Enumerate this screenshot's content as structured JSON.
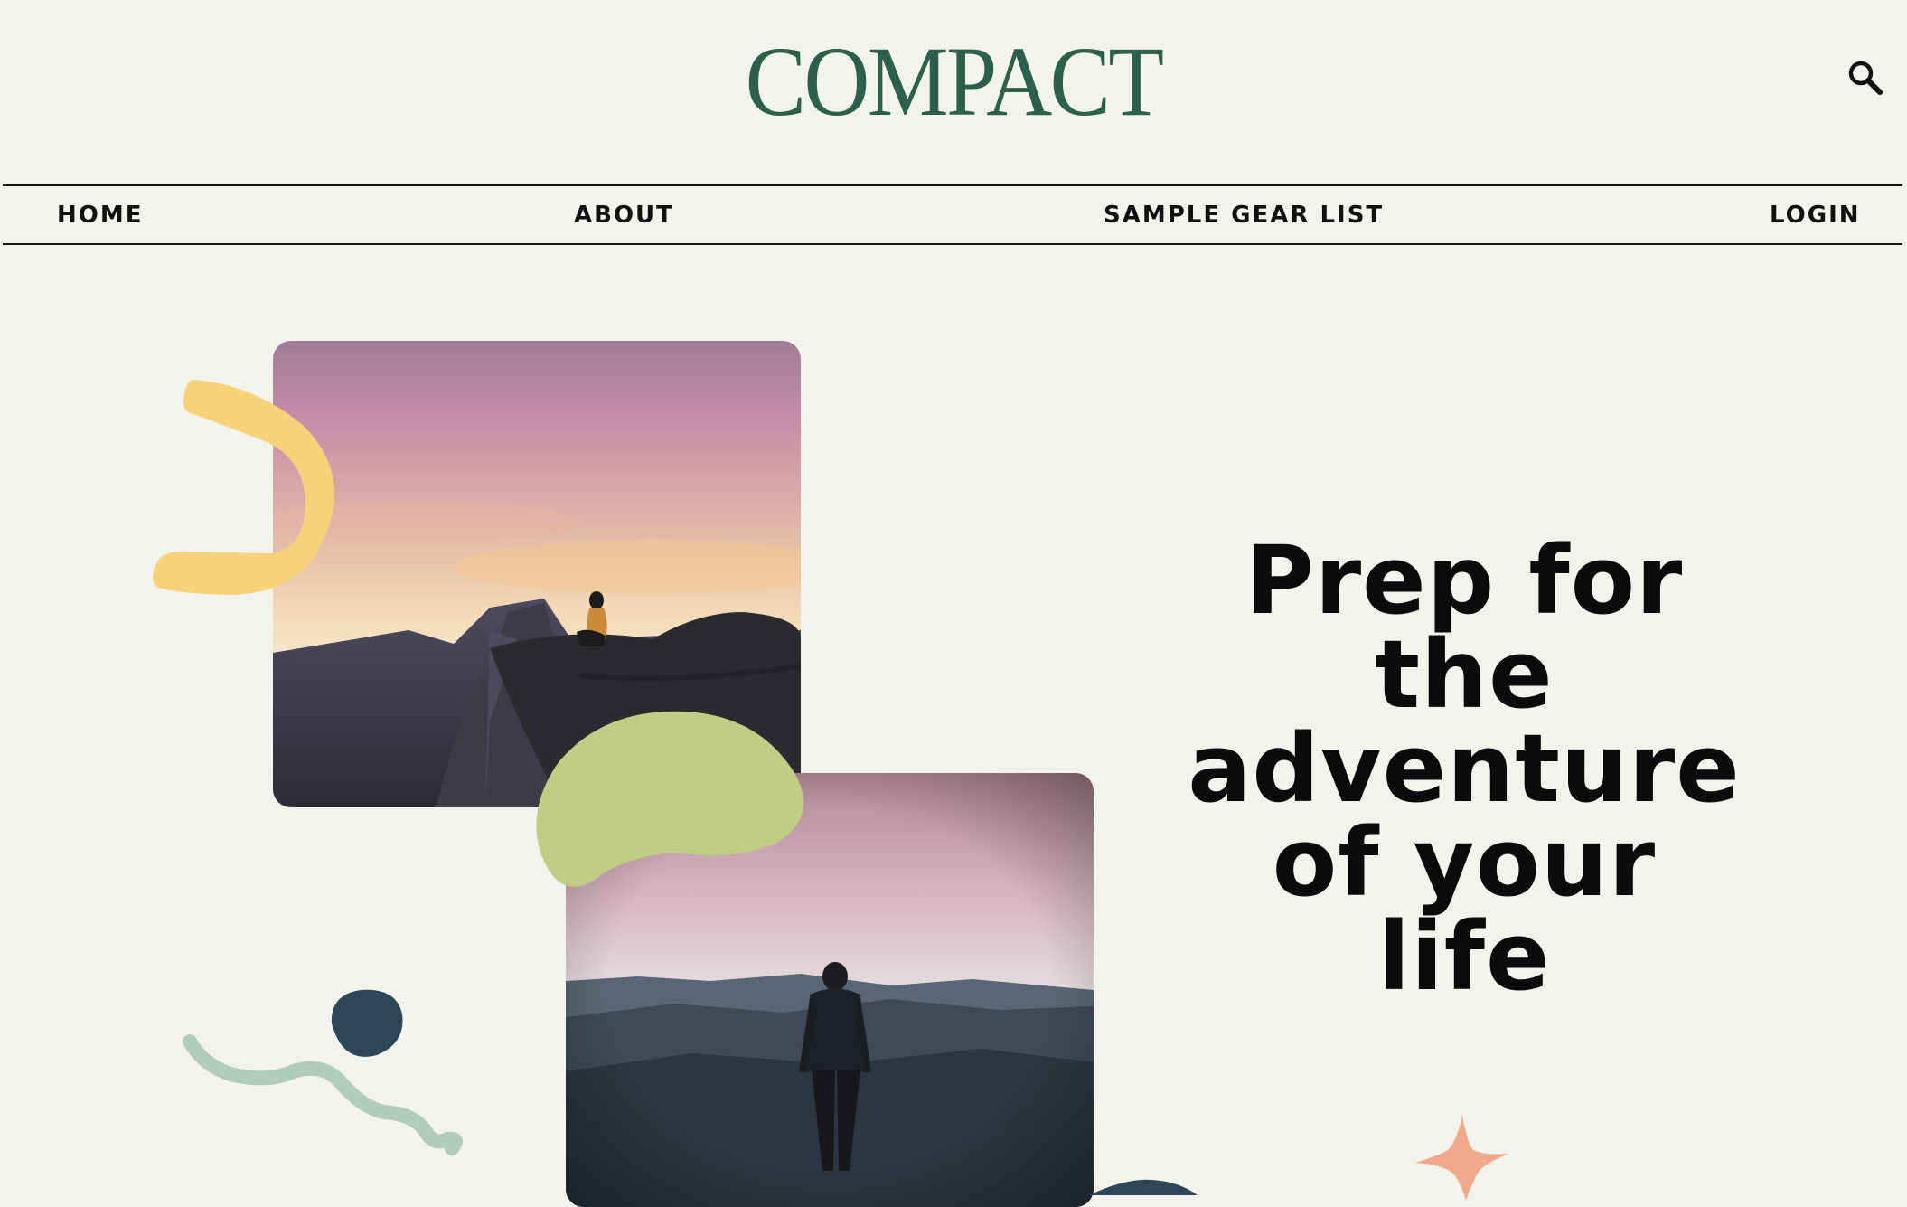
{
  "header": {
    "logo": "COMPACT",
    "search_icon": "search-icon"
  },
  "nav": {
    "items": [
      {
        "label": "HOME"
      },
      {
        "label": "ABOUT"
      },
      {
        "label": "SAMPLE GEAR LIST"
      },
      {
        "label": "LOGIN"
      }
    ]
  },
  "hero": {
    "headline": "Prep for the adventure of your life"
  },
  "colors": {
    "background": "#f3f3ee",
    "logo": "#2d5f4d",
    "yellow_shape": "#f6d37a",
    "green_blob": "#c0cd84",
    "navy_dot": "#2e4657",
    "squiggle": "#b1ccbf",
    "star": "#f0a98a"
  }
}
